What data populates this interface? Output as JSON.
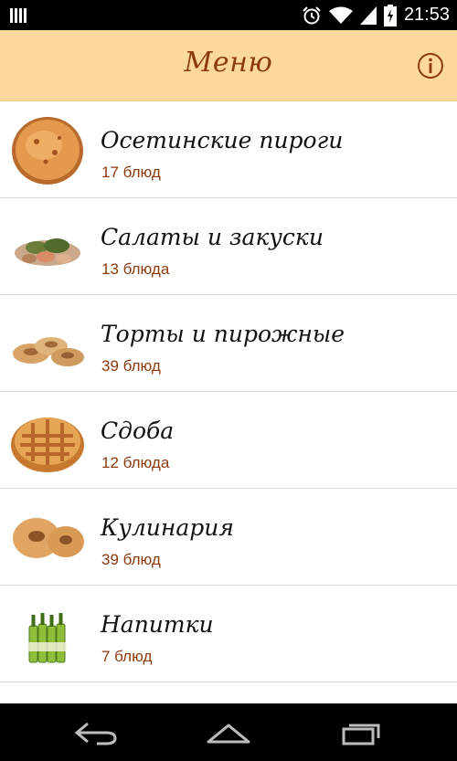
{
  "status_bar": {
    "time": "21:53",
    "icons": [
      "signal-bars-icon",
      "alarm-icon",
      "wifi-icon",
      "cell-signal-icon",
      "battery-charging-icon"
    ]
  },
  "header": {
    "title": "Меню",
    "info_icon": "info-icon"
  },
  "menu": {
    "items": [
      {
        "name": "Осетинские пироги",
        "count": "17 блюд",
        "image": "ossetian-pie-image"
      },
      {
        "name": "Салаты и закуски",
        "count": "13 блюда",
        "image": "salad-image"
      },
      {
        "name": "Торты и пирожные",
        "count": "39 блюд",
        "image": "pastries-image"
      },
      {
        "name": "Сдоба",
        "count": "12 блюда",
        "image": "sweet-pie-image"
      },
      {
        "name": "Кулинария",
        "count": "39 блюд",
        "image": "bagels-image"
      },
      {
        "name": "Напитки",
        "count": "7 блюд",
        "image": "drinks-image"
      }
    ]
  },
  "nav_bar": {
    "buttons": [
      "back-icon",
      "home-icon",
      "recent-apps-icon"
    ]
  },
  "colors": {
    "header_bg": "#fdd89c",
    "accent_brown": "#8b3a0e",
    "divider": "#dcdcdc"
  }
}
